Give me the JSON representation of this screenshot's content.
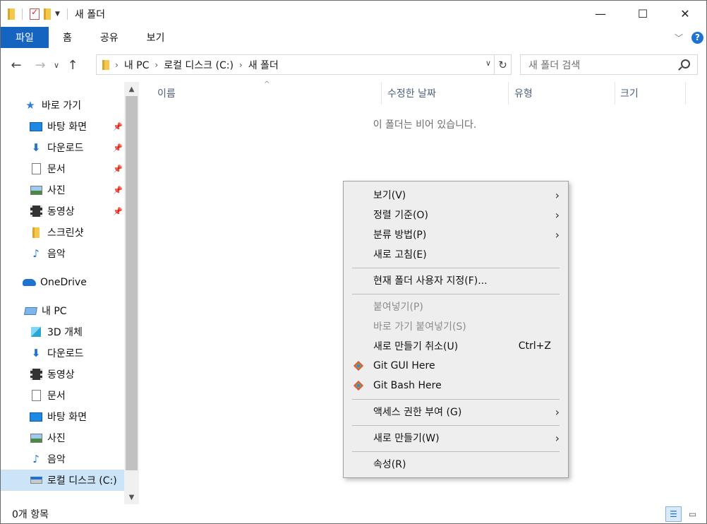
{
  "window": {
    "title": "새 폴더",
    "controls": {
      "minimize": "—",
      "maximize": "☐",
      "close": "✕"
    }
  },
  "ribbon": {
    "tabs": [
      "파일",
      "홈",
      "공유",
      "보기"
    ],
    "help": "?"
  },
  "address": {
    "path": [
      "내 PC",
      "로컬 디스크 (C:)",
      "새 폴더"
    ],
    "search_placeholder": "새 폴더 검색"
  },
  "nav": {
    "items": [
      {
        "label": "바로 가기",
        "icon": "star-icon"
      },
      {
        "label": "바탕 화면",
        "icon": "desktop-icon",
        "pinned": true
      },
      {
        "label": "다운로드",
        "icon": "download-icon",
        "pinned": true
      },
      {
        "label": "문서",
        "icon": "document-icon",
        "pinned": true
      },
      {
        "label": "사진",
        "icon": "picture-icon",
        "pinned": true
      },
      {
        "label": "동영상",
        "icon": "video-icon",
        "pinned": true
      },
      {
        "label": "스크린샷",
        "icon": "folder-icon"
      },
      {
        "label": "음악",
        "icon": "music-icon"
      },
      {
        "label": "OneDrive",
        "icon": "cloud-icon"
      },
      {
        "label": "내 PC",
        "icon": "pc-icon"
      },
      {
        "label": "3D 개체",
        "icon": "cube-icon"
      },
      {
        "label": "다운로드",
        "icon": "download-icon"
      },
      {
        "label": "동영상",
        "icon": "video-icon"
      },
      {
        "label": "문서",
        "icon": "document-icon"
      },
      {
        "label": "바탕 화면",
        "icon": "desktop-icon"
      },
      {
        "label": "사진",
        "icon": "picture-icon"
      },
      {
        "label": "음악",
        "icon": "music-icon"
      },
      {
        "label": "로컬 디스크 (C:)",
        "icon": "drive-icon",
        "selected": true
      }
    ]
  },
  "content": {
    "columns": [
      "이름",
      "수정한 날짜",
      "유형",
      "크기"
    ],
    "empty_message": "이 폴더는 비어 있습니다."
  },
  "status": {
    "item_count": "0개 항목"
  },
  "context_menu": {
    "items": [
      {
        "label": "보기(V)",
        "submenu": true
      },
      {
        "label": "정렬 기준(O)",
        "submenu": true
      },
      {
        "label": "분류 방법(P)",
        "submenu": true
      },
      {
        "label": "새로 고침(E)"
      },
      {
        "label": "현재 폴더 사용자 지정(F)..."
      },
      {
        "label": "붙여넣기(P)",
        "disabled": true
      },
      {
        "label": "바로 가기 붙여넣기(S)",
        "disabled": true
      },
      {
        "label": "새로 만들기 취소(U)",
        "shortcut": "Ctrl+Z"
      },
      {
        "label": "Git GUI Here",
        "icon": "git-icon"
      },
      {
        "label": "Git Bash Here",
        "icon": "git-icon"
      },
      {
        "label": "액세스 권한 부여 (G)",
        "submenu": true
      },
      {
        "label": "새로 만들기(W)",
        "submenu": true
      },
      {
        "label": "속성(R)"
      }
    ]
  }
}
